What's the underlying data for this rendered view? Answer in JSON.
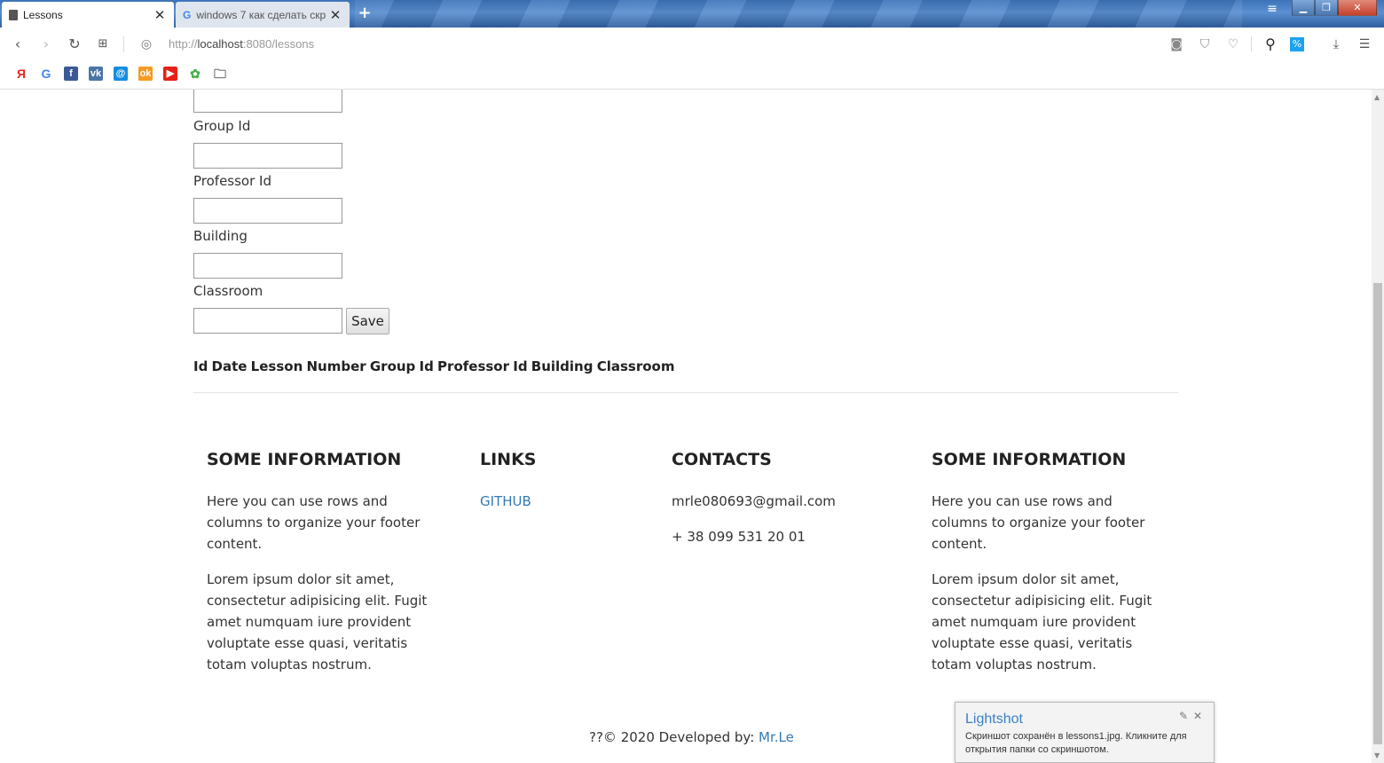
{
  "browser": {
    "tabs": [
      {
        "title": "Lessons",
        "active": true
      },
      {
        "title": "windows 7 как сделать скр",
        "active": false
      }
    ],
    "url_prefix": "http://",
    "url_host": "localhost",
    "url_rest": ":8080/lessons",
    "bookmarks": [
      {
        "icon": "yandex-icon",
        "glyph": "Я",
        "color": "#e52620"
      },
      {
        "icon": "google-icon",
        "glyph": "G",
        "color": "#4285f4"
      },
      {
        "icon": "facebook-icon",
        "glyph": "f",
        "color": "#3b5998"
      },
      {
        "icon": "vk-icon",
        "glyph": "vk",
        "color": "#4a76a8"
      },
      {
        "icon": "mail-icon",
        "glyph": "@",
        "color": "#168de2"
      },
      {
        "icon": "odnoklassniki-icon",
        "glyph": "ok",
        "color": "#f59a22"
      },
      {
        "icon": "youtube-icon",
        "glyph": "▶",
        "color": "#e62117"
      },
      {
        "icon": "flower-icon",
        "glyph": "✿",
        "color": "#4caf50"
      },
      {
        "icon": "folder-icon",
        "glyph": "🗀",
        "color": "#555555"
      }
    ]
  },
  "form": {
    "labels": {
      "group_id": "Group Id",
      "professor_id": "Professor Id",
      "building": "Building",
      "classroom": "Classroom"
    },
    "save_label": "Save"
  },
  "table": {
    "headers": "Id Date Lesson Number Group Id Professor Id Building Classroom"
  },
  "footer": {
    "col1": {
      "title": "SOME INFORMATION",
      "p1": "Here you can use rows and columns to organize your footer content.",
      "p2": "Lorem ipsum dolor sit amet, consectetur adipisicing elit. Fugit amet numquam iure provident voluptate esse quasi, veritatis totam voluptas nostrum."
    },
    "col2": {
      "title": "LINKS",
      "link": "GITHUB"
    },
    "col3": {
      "title": "CONTACTS",
      "email": "mrle080693@gmail.com",
      "phone": "+ 38 099 531 20 01"
    },
    "col4": {
      "title": "SOME INFORMATION",
      "p1": "Here you can use rows and columns to organize your footer content.",
      "p2": "Lorem ipsum dolor sit amet, consectetur adipisicing elit. Fugit amet numquam iure provident voluptate esse quasi, veritatis totam voluptas nostrum."
    },
    "copyright_text": "??© 2020 Developed by: ",
    "copyright_link": "Mr.Le"
  },
  "lightshot": {
    "title": "Lightshot",
    "message": "Скриншот сохранён в lessons1.jpg. Кликните для открытия папки со скриншотом."
  }
}
